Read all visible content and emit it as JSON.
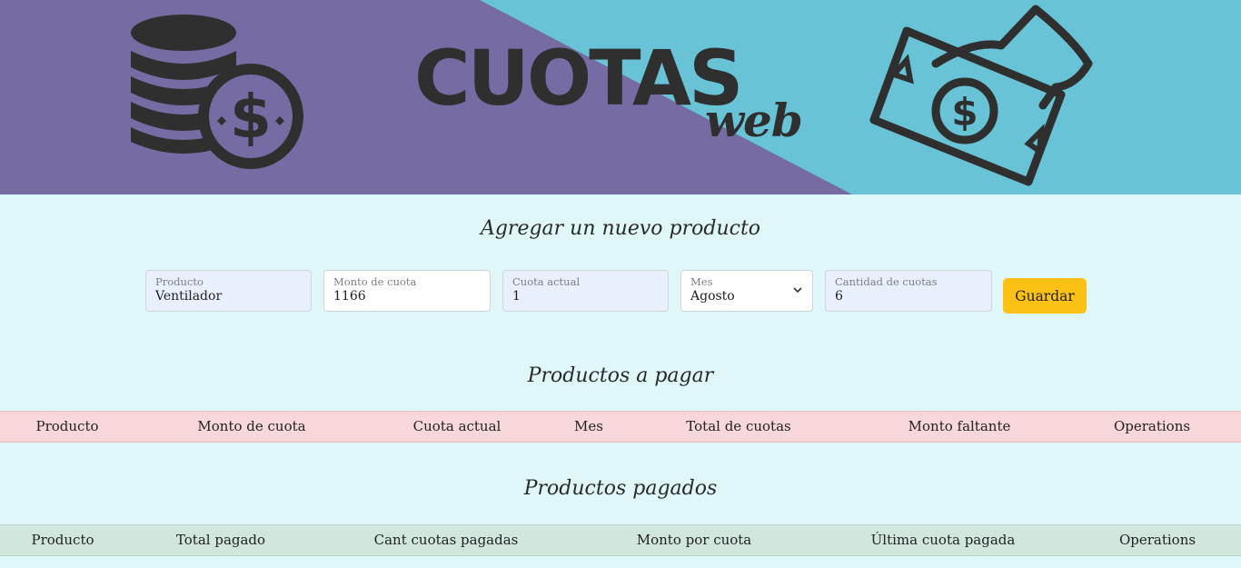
{
  "banner": {
    "title": "CUOTAS",
    "subtitle": "web",
    "colors": {
      "left": "#766ca3",
      "right": "#67c3d5",
      "ink": "#2f2f2f"
    },
    "icons": [
      "coins-stack-icon",
      "money-hand-icon"
    ]
  },
  "form": {
    "title": "Agregar un nuevo producto",
    "fields": [
      {
        "label": "Producto",
        "value": "Ventilador"
      },
      {
        "label": "Monto de cuota",
        "value": "1166"
      },
      {
        "label": "Cuota actual",
        "value": "1"
      },
      {
        "label": "Mes",
        "value": "Agosto"
      },
      {
        "label": "Cantidad de cuotas",
        "value": "6"
      }
    ],
    "save_label": "Guardar",
    "save_color": "#fbc114"
  },
  "pending": {
    "title": "Productos a pagar",
    "columns": [
      "Producto",
      "Monto de cuota",
      "Cuota actual",
      "Mes",
      "Total de cuotas",
      "Monto faltante",
      "Operations"
    ],
    "header_color": "#f8d7da",
    "rows": []
  },
  "paid": {
    "title": "Productos pagados",
    "columns": [
      "Producto",
      "Total pagado",
      "Cant cuotas pagadas",
      "Monto por cuota",
      "Última cuota pagada",
      "Operations"
    ],
    "header_color": "#d1e7dd",
    "rows": []
  }
}
